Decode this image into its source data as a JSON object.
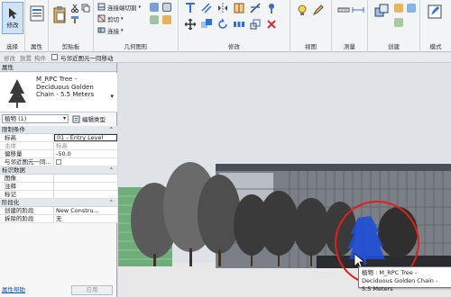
{
  "ribbon": {
    "modify_label": "修改",
    "select_label": "选择",
    "properties_label": "属性",
    "clipboard_label": "剪贴板",
    "geometry_label": "几何图形",
    "modify_group_label": "修改",
    "view_label": "视图",
    "measure_label": "测量",
    "create_label": "创建",
    "mode_label": "模式",
    "connect_end_cut": "连接端切割",
    "cut": "剪切",
    "join": "连接"
  },
  "subbar": {
    "tab1": "修改",
    "tab2": "放置",
    "tab3": "构件",
    "move_with_nearby": "与邻近图元一同移动"
  },
  "properties": {
    "title": "属性",
    "type_name": "M_RPC Tree - Deciduous Golden Chain - 5.5 Meters",
    "category": "植物 (1)",
    "edit_type": "编辑类型",
    "sections": {
      "constraints": "限制条件",
      "identity": "标识数据",
      "phasing": "阶段化"
    },
    "rows": {
      "level_name": "标高",
      "level_value": "01 - Entry Level",
      "host_name": "主体",
      "host_value": "标高",
      "offset_name": "偏移量",
      "offset_value": "-50.0",
      "move_nearby_name": "与邻近图元一同...",
      "image_name": "图像",
      "comments_name": "注释",
      "mark_name": "标记",
      "phase_created_name": "创建的阶段",
      "phase_created_value": "New Constru...",
      "phase_demolished_name": "拆除的阶段",
      "phase_demolished_value": "无"
    },
    "help_link": "属性帮助",
    "apply": "应用"
  },
  "viewport": {
    "tooltip": "植物 : M_RPC Tree - Deciduous Golden Chain - 5.5 Meters"
  },
  "colors": {
    "ribbon_bg": "#f3f4f6",
    "accent_blue": "#2f6fd6",
    "selection_blue": "#1f4fd8",
    "highlight_circle": "#e0201c",
    "hedge_green": "#6fae7a",
    "tree_gray": "#3a3a3a"
  }
}
